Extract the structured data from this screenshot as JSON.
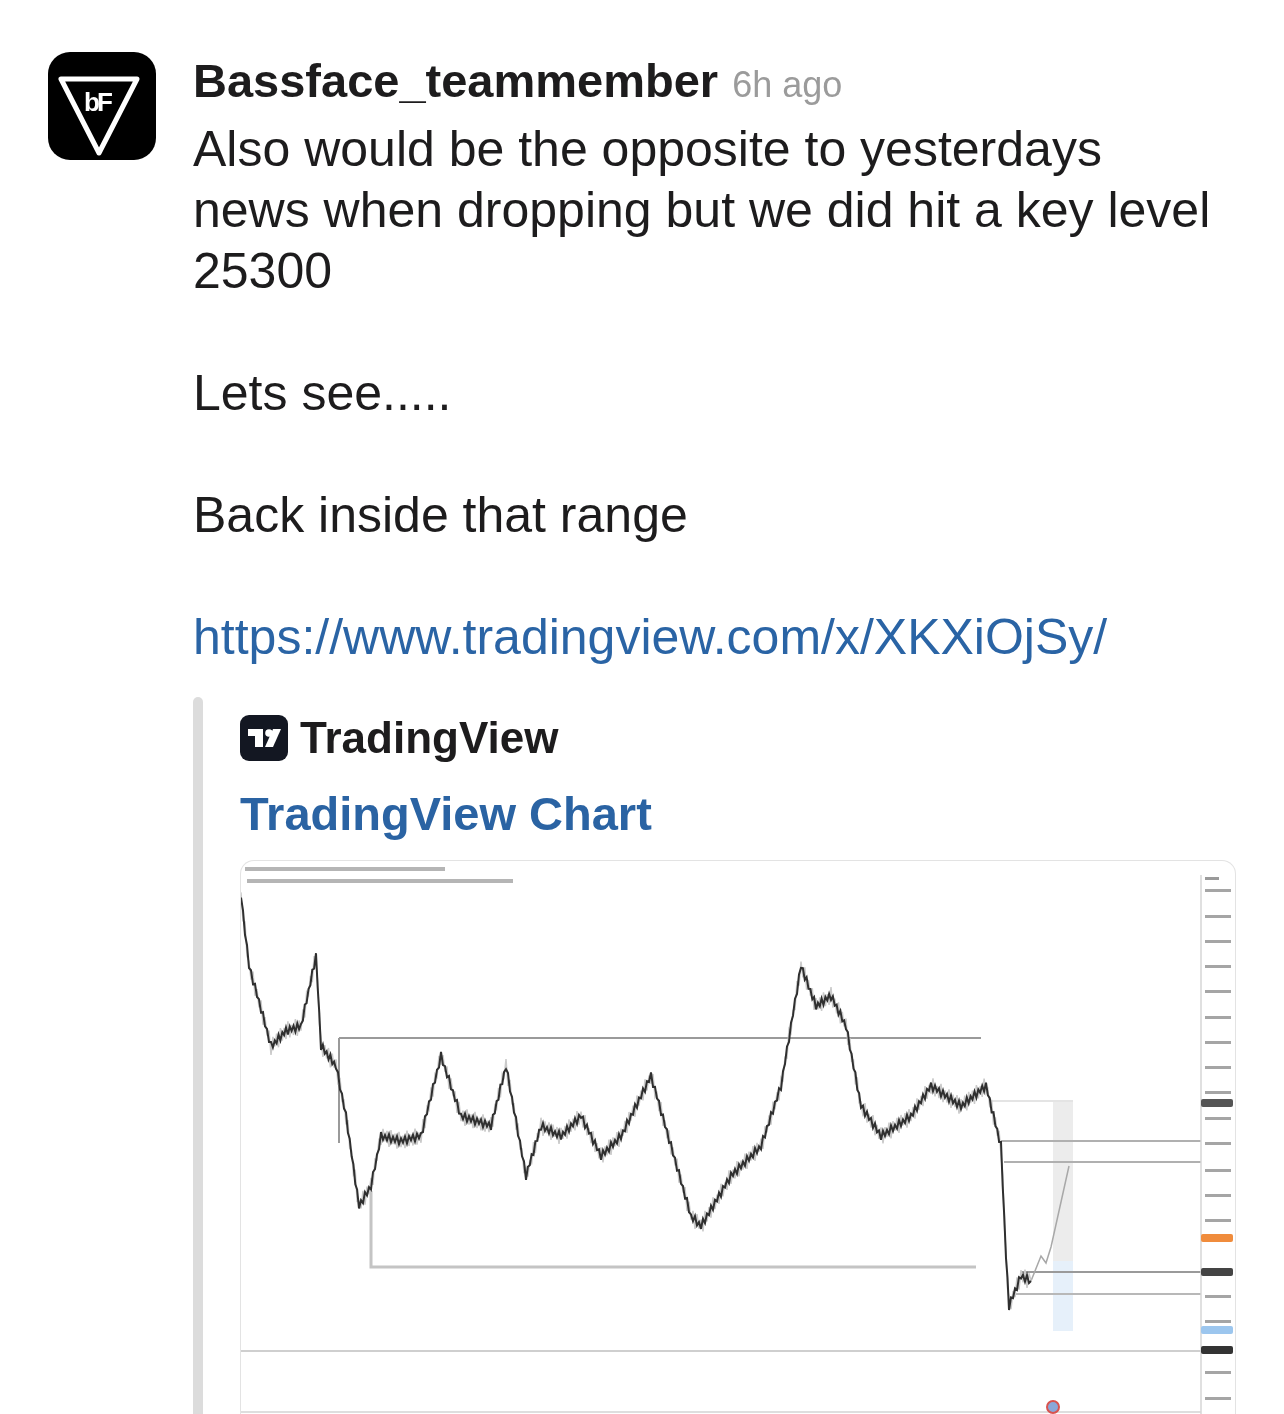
{
  "message": {
    "avatar": {
      "monogram": "bF"
    },
    "author": "Bassface_teammember",
    "time": "6h ago",
    "paragraphs": [
      "Also would be the opposite to yesterdays news when dropping but we did hit a key level 25300",
      "Lets see.....",
      "Back inside that range"
    ],
    "link": "https://www.tradingview.com/x/XKXiOjSy/"
  },
  "attachment": {
    "service_name": "TradingView",
    "title": "TradingView Chart"
  }
}
